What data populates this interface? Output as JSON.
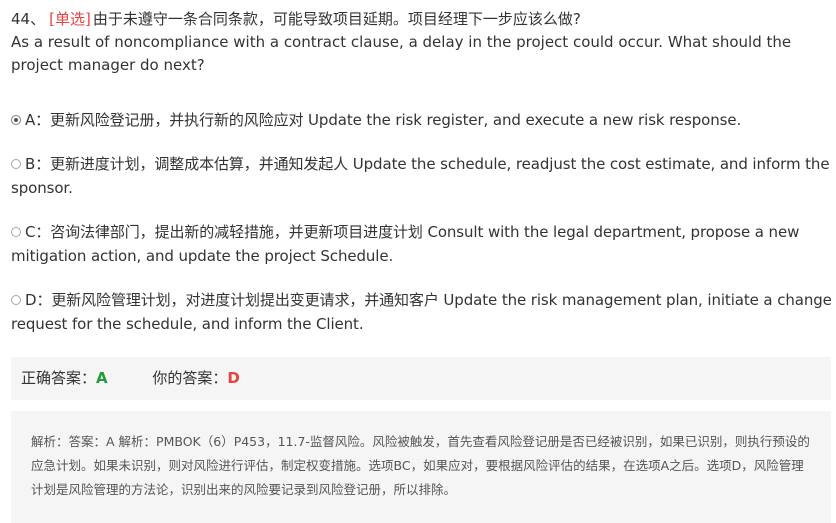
{
  "question": {
    "number": "44、",
    "type": "[单选]",
    "text_cn": "由于未遵守一条合同条款，可能导致项目延期。项目经理下一步应该么做?",
    "text_en": "As a result of noncompliance with a contract clause, a delay in the project could occur. What should the project manager do next?"
  },
  "options": [
    {
      "key": "A",
      "text": "A：更新风险登记册，并执行新的风险应对 Update the risk register, and execute a new risk response.",
      "selected": true
    },
    {
      "key": "B",
      "text": "B：更新进度计划，调整成本估算，并通知发起人 Update the schedule, readjust the cost estimate, and inform the sponsor.",
      "selected": false
    },
    {
      "key": "C",
      "text": "C：咨询法律部门，提出新的减轻措施，并更新项目进度计划 Consult with the legal department, propose a new mitigation action, and update the project Schedule.",
      "selected": false
    },
    {
      "key": "D",
      "text": "D：更新风险管理计划，对进度计划提出变更请求，并通知客户 Update the risk management plan, initiate a change request for the schedule, and inform the Client.",
      "selected": false
    }
  ],
  "answer": {
    "correct_label": "正确答案：",
    "correct_value": "A",
    "yours_label": "你的答案：",
    "yours_value": "D"
  },
  "analysis": {
    "text": "解析：答案：A 解析：PMBOK（6）P453，11.7-监督风险。风险被触发，首先查看风险登记册是否已经被识别，如果已识别，则执行预设的应急计划。如果未识别，则对风险进行评估，制定权变措施。选项BC，如果应对，要根据风险评估的结果，在选项A之后。选项D，风险管理计划是风险管理的方法论，识别出来的风险要记录到风险登记册，所以排除。"
  },
  "colors": {
    "question_type": "#e64340",
    "correct": "#1f9d3a",
    "wrong": "#e64340",
    "panel_bg": "#f5f5f5"
  }
}
